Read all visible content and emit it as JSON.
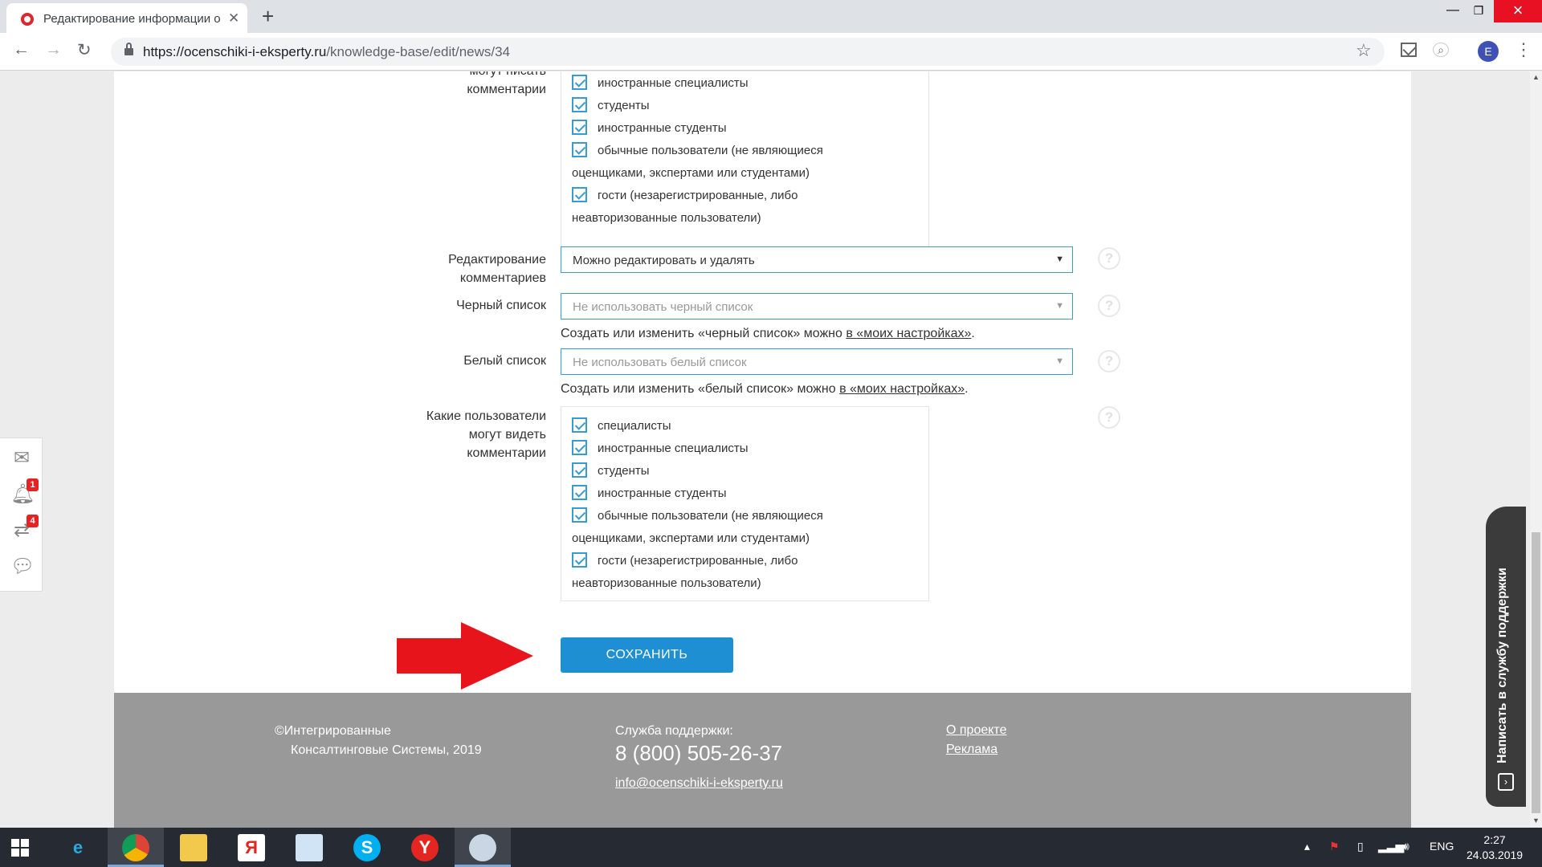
{
  "browser": {
    "tab_title": "Редактирование информации о",
    "url_host": "https://ocenschiki-i-eksperty.ru",
    "url_path": "/knowledge-base/edit/news/34",
    "profile_initial": "E"
  },
  "form": {
    "write_comments": {
      "label_line1": "могут писать",
      "label_line2": "комментарии",
      "options": [
        "иностранные специалисты",
        "студенты",
        "иностранные студенты",
        "обычные пользователи (не являющиеся",
        "гости (незарегистрированные, либо"
      ],
      "option4_cont": "оценщиками, экспертами или студентами)",
      "option5_cont": "неавторизованные пользователи)"
    },
    "edit_comments": {
      "label_line1": "Редактирование",
      "label_line2": "комментариев",
      "value": "Можно редактировать и удалять"
    },
    "blacklist": {
      "label": "Черный список",
      "placeholder": "Не использовать черный список",
      "hint_text": "Создать или изменить «черный список» можно ",
      "hint_link": "в «моих настройках»",
      "hint_end": "."
    },
    "whitelist": {
      "label": "Белый список",
      "placeholder": "Не использовать белый список",
      "hint_text": "Создать или изменить «белый список» можно ",
      "hint_link": "в «моих настройках»",
      "hint_end": "."
    },
    "view_comments": {
      "label_line1": "Какие пользователи",
      "label_line2": "могут видеть",
      "label_line3": "комментарии",
      "options": [
        "специалисты",
        "иностранные специалисты",
        "студенты",
        "иностранные студенты",
        "обычные пользователи (не являющиеся",
        "гости (незарегистрированные, либо"
      ],
      "option5_cont": "оценщиками, экспертами или студентами)",
      "option6_cont": "неавторизованные пользователи)"
    },
    "help_glyph": "?",
    "save_label": "СОХРАНИТЬ"
  },
  "footer": {
    "copyright_line1": "©Интегрированные",
    "copyright_line2": "Консалтинговые Системы, 2019",
    "support_label": "Служба поддержки:",
    "phone": "8 (800) 505-26-37",
    "email": "info@ocenschiki-i-eksperty.ru",
    "link_about": "О проекте",
    "link_ads": "Реклама"
  },
  "side_bar": {
    "notifications_count": "1",
    "exchange_count": "4"
  },
  "support_tab": {
    "label": "Написать в службу поддержки"
  },
  "taskbar": {
    "language": "ENG",
    "time": "2:27",
    "date": "24.03.2019"
  },
  "colors": {
    "accent": "#1e8fd2",
    "checkbox": "#3a9bd1",
    "footer_bg": "#999999",
    "arrow": "#e8141c"
  }
}
